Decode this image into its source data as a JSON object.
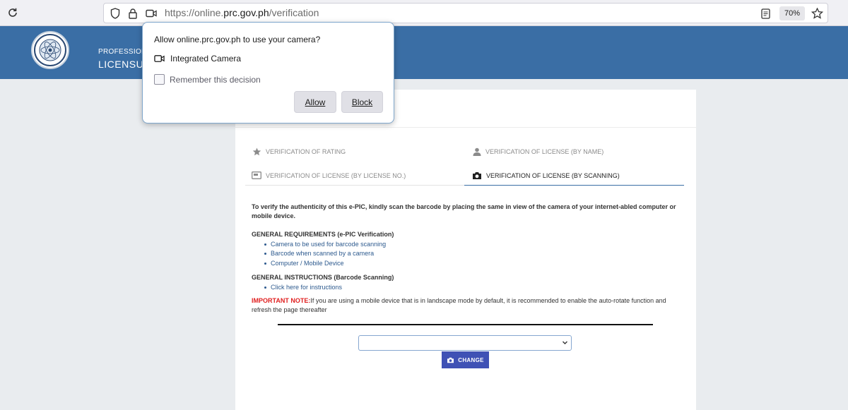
{
  "browser": {
    "url_prefix": "https://online.",
    "url_domain": "prc.gov.ph",
    "url_path": "/verification",
    "zoom": "70%"
  },
  "header": {
    "line1": "PROFESSIONA",
    "line2": "LICENSUR"
  },
  "permission_popup": {
    "title": "Allow online.prc.gov.ph to use your camera?",
    "camera": "Integrated Camera",
    "remember": "Remember this decision",
    "allow": "Allow",
    "block": "Block"
  },
  "tabs": {
    "rating": "VERIFICATION OF RATING",
    "by_name": "VERIFICATION OF LICENSE (BY NAME)",
    "by_license_no": "VERIFICATION OF LICENSE (BY LICENSE NO.)",
    "by_scanning": "VERIFICATION OF LICENSE (BY SCANNING)"
  },
  "content": {
    "intro": "To verify the authenticity of this e-PIC, kindly scan the barcode by placing the same in view of the camera of your internet-abled computer or mobile device.",
    "requirements_title": "GENERAL REQUIREMENTS (e-PIC Verification)",
    "requirements": [
      "Camera to be used for barcode scanning",
      "Barcode when scanned by a camera",
      "Computer / Mobile Device"
    ],
    "instructions_title": "GENERAL INSTRUCTIONS (Barcode Scanning)",
    "instructions_link": "Click here for instructions",
    "note_label": "IMPORTANT NOTE:",
    "note_text": "If you are using a mobile device that is in landscape mode by default, it is recommended to enable the auto-rotate function and refresh the page thereafter"
  },
  "camera_select": {
    "value": ""
  },
  "change_button": "CHANGE",
  "colors": {
    "header_blue": "#3a6ea5",
    "button_indigo": "#3f51b5",
    "important_red": "#e02020",
    "link_blue": "#2d5a8e"
  }
}
